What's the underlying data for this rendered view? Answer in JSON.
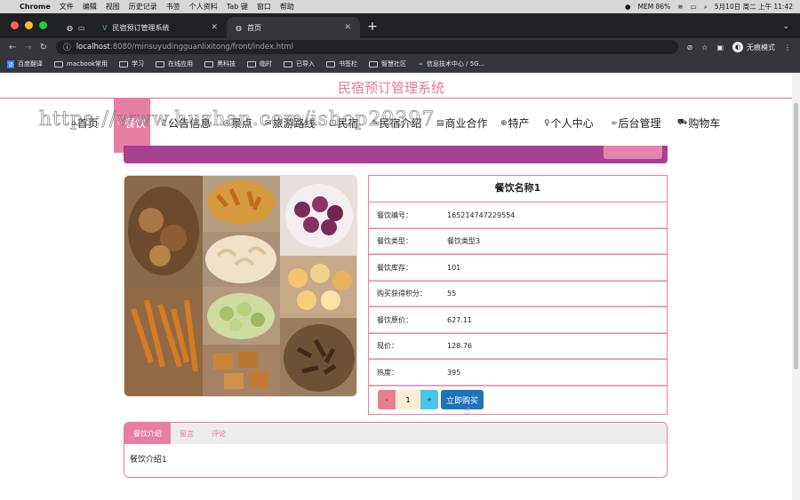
{
  "mac_menubar": {
    "app": "Chrome",
    "menus": [
      "文件",
      "编辑",
      "视图",
      "历史记录",
      "书签",
      "个人资料",
      "Tab 键",
      "窗口",
      "帮助"
    ],
    "mem": "MEM 86%",
    "datetime": "5月10日 周二 上午 11:42"
  },
  "browser": {
    "tabs": [
      {
        "label": "",
        "state": "pinned"
      },
      {
        "label": "民宿预订管理系统",
        "state": "inactive"
      },
      {
        "label": "首页",
        "state": "active"
      }
    ],
    "url_host": "localhost",
    "url_path": ":8080/minsuyudingguanlixitong/front/index.html",
    "incognito_label": "无痕模式",
    "bookmarks": [
      "百度翻译",
      "macbook常用",
      "学习",
      "在线应用",
      "黑科技",
      "临时",
      "已导入",
      "书签栏",
      "智慧社区",
      "信息技术中心 / 5G..."
    ]
  },
  "site": {
    "title": "民宿预订管理系统",
    "watermark": "https://www.huzhan.com/ishop29397",
    "menu": [
      {
        "label": "首页",
        "icon": "home-icon",
        "glyph": "⌂",
        "active": false
      },
      {
        "label": "餐饮",
        "icon": "star-icon",
        "glyph": "☆",
        "active": true
      },
      {
        "label": "公告信息",
        "icon": "bell-icon",
        "glyph": "♫",
        "active": false
      },
      {
        "label": "景点",
        "icon": "pin-icon",
        "glyph": "◎",
        "active": false
      },
      {
        "label": "旅游路线",
        "icon": "route-icon",
        "glyph": "✉",
        "active": false
      },
      {
        "label": "民宿",
        "icon": "house-icon",
        "glyph": "▢",
        "active": false
      },
      {
        "label": "民宿介绍",
        "icon": "info-icon",
        "glyph": "✎",
        "active": false
      },
      {
        "label": "商业合作",
        "icon": "handshake-icon",
        "glyph": "▤",
        "active": false
      },
      {
        "label": "特产",
        "icon": "globe-icon",
        "glyph": "⊕",
        "active": false
      },
      {
        "label": "个人中心",
        "icon": "user-icon",
        "glyph": "♀",
        "active": false
      },
      {
        "label": "后台管理",
        "icon": "link-icon",
        "glyph": "∞",
        "active": false
      },
      {
        "label": "购物车",
        "icon": "cart-icon",
        "glyph": "⛟",
        "active": false
      }
    ]
  },
  "product": {
    "name": "餐饮名称1",
    "fields": [
      {
        "key": "餐饮编号：",
        "value": "165214747229554"
      },
      {
        "key": "餐饮类型：",
        "value": "餐饮类型3"
      },
      {
        "key": "餐饮库存：",
        "value": "101"
      },
      {
        "key": "购买获得积分：",
        "value": "55"
      },
      {
        "key": "餐饮原价：",
        "value": "627.11"
      },
      {
        "key": "现价：",
        "value": "128.76"
      },
      {
        "key": "热度：",
        "value": "395"
      }
    ],
    "quantity": "1",
    "minus_label": "-",
    "plus_label": "+",
    "buy_label": "立即购买"
  },
  "info_tabs": {
    "tabs": [
      {
        "label": "餐饮介绍",
        "active": true
      },
      {
        "label": "留言",
        "active": false
      },
      {
        "label": "评论",
        "active": false
      }
    ],
    "content": "餐饮介绍1"
  },
  "colors": {
    "brand_pink": "#e77fa5",
    "bar_purple": "#a5418e",
    "buy_blue": "#1e73b9",
    "minus_red": "#e77f8f",
    "plus_cyan": "#48c6e8"
  }
}
